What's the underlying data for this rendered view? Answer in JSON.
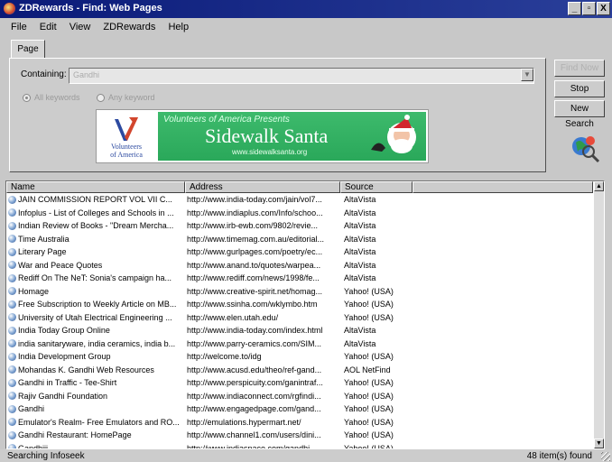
{
  "window": {
    "title": "ZDRewards - Find: Web Pages"
  },
  "title_buttons": [
    "_",
    "▫",
    "X"
  ],
  "menu": [
    "File",
    "Edit",
    "View",
    "ZDRewards",
    "Help"
  ],
  "tab": "Page",
  "search": {
    "containing_label": "Containing:",
    "value": "Gandhi",
    "radio_all": "All keywords",
    "radio_any": "Any keyword"
  },
  "banner": {
    "logo_line1": "Volunteers",
    "logo_line2": "of America",
    "tagline": "Volunteers of America Presents",
    "headline": "Sidewalk Santa",
    "url": "www.sidewalksanta.org"
  },
  "buttons": {
    "find_now": "Find Now",
    "stop": "Stop",
    "new_search": "New Search"
  },
  "columns": [
    "Name",
    "Address",
    "Source"
  ],
  "rows": [
    {
      "name": "JAIN COMMISSION REPORT VOL VII C...",
      "address": "http://www.india-today.com/jain/vol7...",
      "source": "AltaVista"
    },
    {
      "name": "Infoplus - List of Colleges and Schools in ...",
      "address": "http://www.indiaplus.com/Info/schoo...",
      "source": "AltaVista"
    },
    {
      "name": "Indian Review of Books - \"Dream Mercha...",
      "address": "http://www.irb-ewb.com/9802/revie...",
      "source": "AltaVista"
    },
    {
      "name": "Time Australia",
      "address": "http://www.timemag.com.au/editorial...",
      "source": "AltaVista"
    },
    {
      "name": "Literary Page",
      "address": "http://www.gurlpages.com/poetry/ec...",
      "source": "AltaVista"
    },
    {
      "name": "War and Peace Quotes",
      "address": "http://www.anand.to/quotes/warpea...",
      "source": "AltaVista"
    },
    {
      "name": "Rediff On The NeT: Sonia's campaign ha...",
      "address": "http://www.rediff.com/news/1998/fe...",
      "source": "AltaVista"
    },
    {
      "name": "Homage",
      "address": "http://www.creative-spirit.net/homag...",
      "source": "Yahoo! (USA)"
    },
    {
      "name": "Free Subscription to Weekly Article on MB...",
      "address": "http://www.ssinha.com/wklymbo.htm",
      "source": "Yahoo! (USA)"
    },
    {
      "name": "University of Utah Electrical Engineering ...",
      "address": "http://www.elen.utah.edu/",
      "source": "Yahoo! (USA)"
    },
    {
      "name": "India Today Group Online",
      "address": "http://www.india-today.com/index.html",
      "source": "AltaVista"
    },
    {
      "name": "india sanitaryware, india ceramics, india b...",
      "address": "http://www.parry-ceramics.com/SIM...",
      "source": "AltaVista"
    },
    {
      "name": "India Development Group",
      "address": "http://welcome.to/idg",
      "source": "Yahoo! (USA)"
    },
    {
      "name": "Mohandas K. Gandhi Web Resources",
      "address": "http://www.acusd.edu/theo/ref-gand...",
      "source": "AOL NetFind"
    },
    {
      "name": "Gandhi in Traffic - Tee-Shirt",
      "address": "http://www.perspicuity.com/ganintraf...",
      "source": "Yahoo! (USA)"
    },
    {
      "name": "Rajiv Gandhi Foundation",
      "address": "http://www.indiaconnect.com/rgfindi...",
      "source": "Yahoo! (USA)"
    },
    {
      "name": "Gandhi",
      "address": "http://www.engagedpage.com/gand...",
      "source": "Yahoo! (USA)"
    },
    {
      "name": "Emulator's Realm- Free Emulators and RO...",
      "address": "http://emulations.hypermart.net/",
      "source": "Yahoo! (USA)"
    },
    {
      "name": "Gandhi Restaurant: HomePage",
      "address": "http://www.channel1.com/users/dini...",
      "source": "Yahoo! (USA)"
    },
    {
      "name": "Gandhiji",
      "address": "http://www.indiaspace.com/gandhi...",
      "source": "Yahoo! (USA)"
    }
  ],
  "status": {
    "left": "Searching Infoseek",
    "right": "48 item(s) found"
  },
  "colors": {
    "titlebar": "#0a1a78",
    "banner_green": "#2aa85a",
    "window_face": "#c8c8c8"
  }
}
